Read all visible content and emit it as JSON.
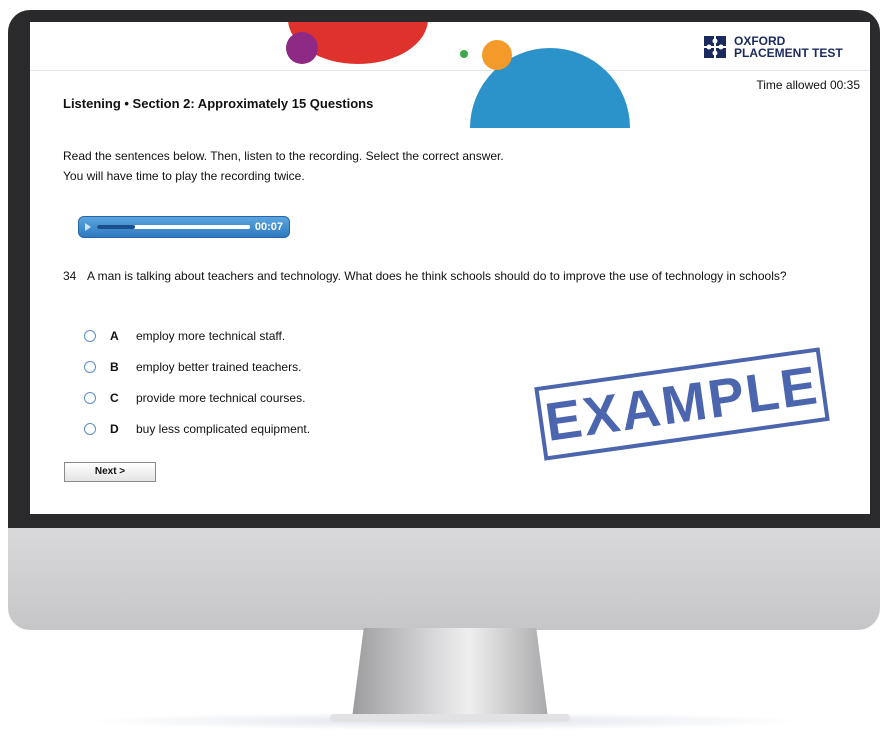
{
  "header": {
    "logo_line1": "OXFORD",
    "logo_line2": "PLACEMENT TEST",
    "time_allowed": "Time allowed 00:35"
  },
  "section": {
    "title": "Listening • Section 2: Approximately 15 Questions",
    "instruction1": "Read the sentences below. Then, listen to the recording. Select the correct answer.",
    "instruction2": "You will have time to play the recording twice."
  },
  "player": {
    "time": "00:07",
    "progress": 0.25
  },
  "question": {
    "number": "34",
    "text": "A man is talking about teachers and technology. What does he think schools should do to improve the use of technology in schools?"
  },
  "options": [
    {
      "letter": "A",
      "text": "employ more technical staff."
    },
    {
      "letter": "B",
      "text": "employ better trained teachers."
    },
    {
      "letter": "C",
      "text": "provide more technical courses."
    },
    {
      "letter": "D",
      "text": "buy less complicated equipment."
    }
  ],
  "next_label": "Next >",
  "stamp_text": "EXAMPLE",
  "colors": {
    "brand": "#1b2a5e",
    "player": "#2f79c0",
    "radio": "#5b8fc6",
    "stamp": "#2c4ba0"
  }
}
